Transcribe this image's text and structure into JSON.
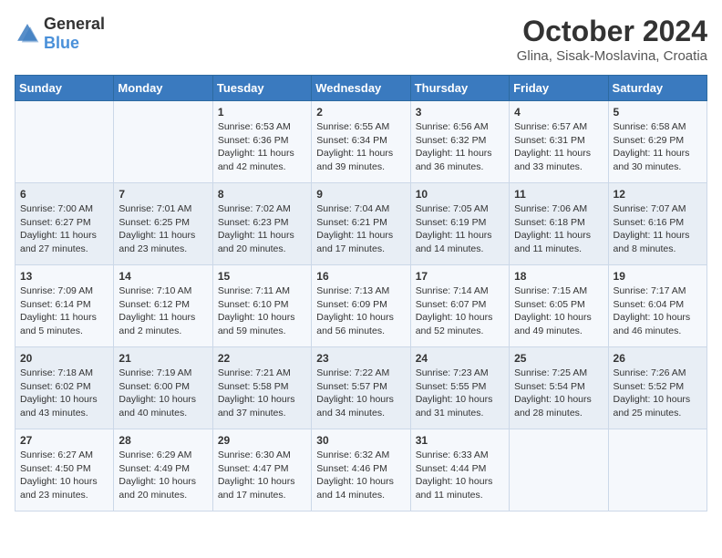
{
  "header": {
    "logo_general": "General",
    "logo_blue": "Blue",
    "title": "October 2024",
    "subtitle": "Glina, Sisak-Moslavina, Croatia"
  },
  "days_of_week": [
    "Sunday",
    "Monday",
    "Tuesday",
    "Wednesday",
    "Thursday",
    "Friday",
    "Saturday"
  ],
  "weeks": [
    [
      {
        "day": "",
        "sunrise": "",
        "sunset": "",
        "daylight": ""
      },
      {
        "day": "",
        "sunrise": "",
        "sunset": "",
        "daylight": ""
      },
      {
        "day": "1",
        "sunrise": "Sunrise: 6:53 AM",
        "sunset": "Sunset: 6:36 PM",
        "daylight": "Daylight: 11 hours and 42 minutes."
      },
      {
        "day": "2",
        "sunrise": "Sunrise: 6:55 AM",
        "sunset": "Sunset: 6:34 PM",
        "daylight": "Daylight: 11 hours and 39 minutes."
      },
      {
        "day": "3",
        "sunrise": "Sunrise: 6:56 AM",
        "sunset": "Sunset: 6:32 PM",
        "daylight": "Daylight: 11 hours and 36 minutes."
      },
      {
        "day": "4",
        "sunrise": "Sunrise: 6:57 AM",
        "sunset": "Sunset: 6:31 PM",
        "daylight": "Daylight: 11 hours and 33 minutes."
      },
      {
        "day": "5",
        "sunrise": "Sunrise: 6:58 AM",
        "sunset": "Sunset: 6:29 PM",
        "daylight": "Daylight: 11 hours and 30 minutes."
      }
    ],
    [
      {
        "day": "6",
        "sunrise": "Sunrise: 7:00 AM",
        "sunset": "Sunset: 6:27 PM",
        "daylight": "Daylight: 11 hours and 27 minutes."
      },
      {
        "day": "7",
        "sunrise": "Sunrise: 7:01 AM",
        "sunset": "Sunset: 6:25 PM",
        "daylight": "Daylight: 11 hours and 23 minutes."
      },
      {
        "day": "8",
        "sunrise": "Sunrise: 7:02 AM",
        "sunset": "Sunset: 6:23 PM",
        "daylight": "Daylight: 11 hours and 20 minutes."
      },
      {
        "day": "9",
        "sunrise": "Sunrise: 7:04 AM",
        "sunset": "Sunset: 6:21 PM",
        "daylight": "Daylight: 11 hours and 17 minutes."
      },
      {
        "day": "10",
        "sunrise": "Sunrise: 7:05 AM",
        "sunset": "Sunset: 6:19 PM",
        "daylight": "Daylight: 11 hours and 14 minutes."
      },
      {
        "day": "11",
        "sunrise": "Sunrise: 7:06 AM",
        "sunset": "Sunset: 6:18 PM",
        "daylight": "Daylight: 11 hours and 11 minutes."
      },
      {
        "day": "12",
        "sunrise": "Sunrise: 7:07 AM",
        "sunset": "Sunset: 6:16 PM",
        "daylight": "Daylight: 11 hours and 8 minutes."
      }
    ],
    [
      {
        "day": "13",
        "sunrise": "Sunrise: 7:09 AM",
        "sunset": "Sunset: 6:14 PM",
        "daylight": "Daylight: 11 hours and 5 minutes."
      },
      {
        "day": "14",
        "sunrise": "Sunrise: 7:10 AM",
        "sunset": "Sunset: 6:12 PM",
        "daylight": "Daylight: 11 hours and 2 minutes."
      },
      {
        "day": "15",
        "sunrise": "Sunrise: 7:11 AM",
        "sunset": "Sunset: 6:10 PM",
        "daylight": "Daylight: 10 hours and 59 minutes."
      },
      {
        "day": "16",
        "sunrise": "Sunrise: 7:13 AM",
        "sunset": "Sunset: 6:09 PM",
        "daylight": "Daylight: 10 hours and 56 minutes."
      },
      {
        "day": "17",
        "sunrise": "Sunrise: 7:14 AM",
        "sunset": "Sunset: 6:07 PM",
        "daylight": "Daylight: 10 hours and 52 minutes."
      },
      {
        "day": "18",
        "sunrise": "Sunrise: 7:15 AM",
        "sunset": "Sunset: 6:05 PM",
        "daylight": "Daylight: 10 hours and 49 minutes."
      },
      {
        "day": "19",
        "sunrise": "Sunrise: 7:17 AM",
        "sunset": "Sunset: 6:04 PM",
        "daylight": "Daylight: 10 hours and 46 minutes."
      }
    ],
    [
      {
        "day": "20",
        "sunrise": "Sunrise: 7:18 AM",
        "sunset": "Sunset: 6:02 PM",
        "daylight": "Daylight: 10 hours and 43 minutes."
      },
      {
        "day": "21",
        "sunrise": "Sunrise: 7:19 AM",
        "sunset": "Sunset: 6:00 PM",
        "daylight": "Daylight: 10 hours and 40 minutes."
      },
      {
        "day": "22",
        "sunrise": "Sunrise: 7:21 AM",
        "sunset": "Sunset: 5:58 PM",
        "daylight": "Daylight: 10 hours and 37 minutes."
      },
      {
        "day": "23",
        "sunrise": "Sunrise: 7:22 AM",
        "sunset": "Sunset: 5:57 PM",
        "daylight": "Daylight: 10 hours and 34 minutes."
      },
      {
        "day": "24",
        "sunrise": "Sunrise: 7:23 AM",
        "sunset": "Sunset: 5:55 PM",
        "daylight": "Daylight: 10 hours and 31 minutes."
      },
      {
        "day": "25",
        "sunrise": "Sunrise: 7:25 AM",
        "sunset": "Sunset: 5:54 PM",
        "daylight": "Daylight: 10 hours and 28 minutes."
      },
      {
        "day": "26",
        "sunrise": "Sunrise: 7:26 AM",
        "sunset": "Sunset: 5:52 PM",
        "daylight": "Daylight: 10 hours and 25 minutes."
      }
    ],
    [
      {
        "day": "27",
        "sunrise": "Sunrise: 6:27 AM",
        "sunset": "Sunset: 4:50 PM",
        "daylight": "Daylight: 10 hours and 23 minutes."
      },
      {
        "day": "28",
        "sunrise": "Sunrise: 6:29 AM",
        "sunset": "Sunset: 4:49 PM",
        "daylight": "Daylight: 10 hours and 20 minutes."
      },
      {
        "day": "29",
        "sunrise": "Sunrise: 6:30 AM",
        "sunset": "Sunset: 4:47 PM",
        "daylight": "Daylight: 10 hours and 17 minutes."
      },
      {
        "day": "30",
        "sunrise": "Sunrise: 6:32 AM",
        "sunset": "Sunset: 4:46 PM",
        "daylight": "Daylight: 10 hours and 14 minutes."
      },
      {
        "day": "31",
        "sunrise": "Sunrise: 6:33 AM",
        "sunset": "Sunset: 4:44 PM",
        "daylight": "Daylight: 10 hours and 11 minutes."
      },
      {
        "day": "",
        "sunrise": "",
        "sunset": "",
        "daylight": ""
      },
      {
        "day": "",
        "sunrise": "",
        "sunset": "",
        "daylight": ""
      }
    ]
  ]
}
